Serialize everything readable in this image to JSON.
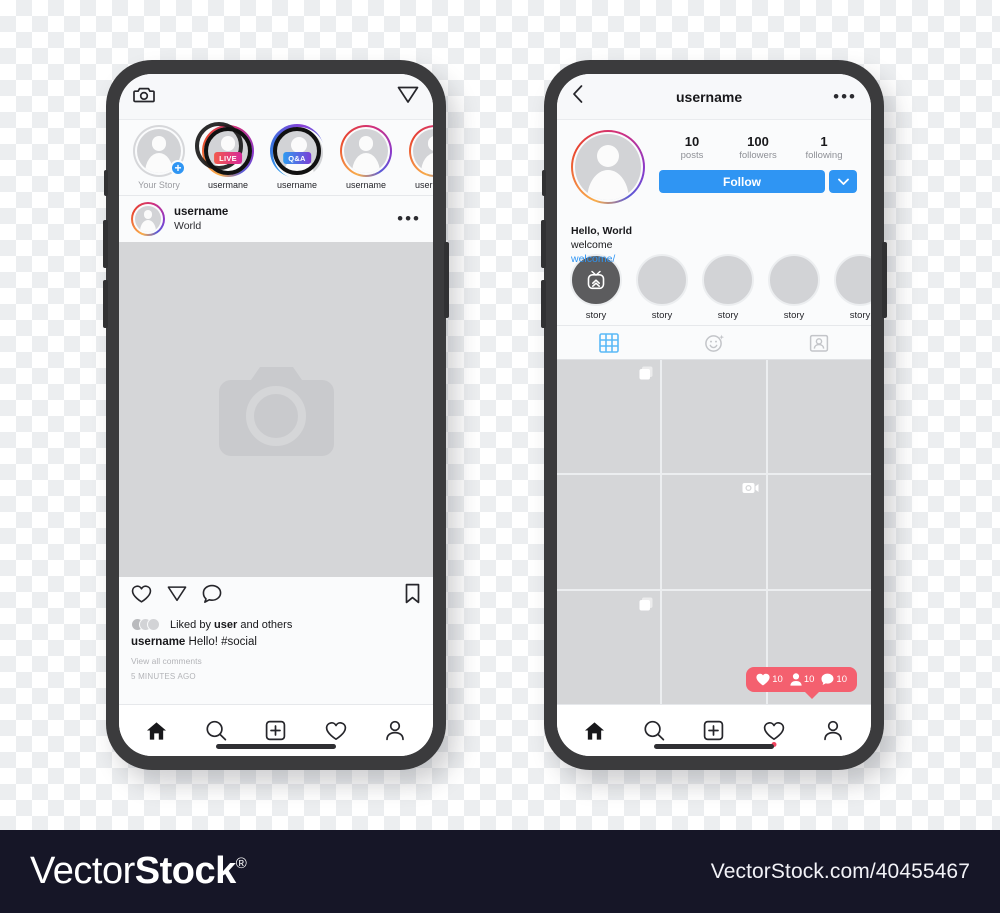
{
  "feed_phone": {
    "topbar": {
      "camera_icon": "camera-icon",
      "direct_icon": "paper-plane-icon"
    },
    "stories": [
      {
        "label": "Your Story",
        "ring": "none",
        "badge": null,
        "has_plus": true
      },
      {
        "label": "usermane",
        "ring": "gradient",
        "badge": "LIVE",
        "has_plus": false
      },
      {
        "label": "username",
        "ring": "blue-gradient",
        "badge": "Q&A",
        "has_plus": false
      },
      {
        "label": "username",
        "ring": "gradient",
        "badge": null,
        "has_plus": false
      },
      {
        "label": "username",
        "ring": "gradient",
        "badge": null,
        "has_plus": false
      }
    ],
    "post": {
      "username": "username",
      "location": "World",
      "more_icon": "more-options-icon",
      "actions": [
        "heart-icon",
        "paper-plane-icon",
        "comment-icon",
        "bookmark-icon"
      ],
      "likes_prefix": "Liked by ",
      "likes_user": "user",
      "likes_suffix": " and others",
      "caption_user": "username",
      "caption_text": " Hello! #social",
      "view_comments": "View all comments",
      "time_ago": "5 MINUTES AGO"
    },
    "bottom_nav": [
      "home-icon",
      "search-icon",
      "add-post-icon",
      "activity-icon",
      "profile-icon"
    ]
  },
  "profile_phone": {
    "topbar": {
      "back_icon": "back-chevron-icon",
      "title": "username",
      "more_icon": "more-options-icon"
    },
    "stats": [
      {
        "num": "10",
        "label": "posts"
      },
      {
        "num": "100",
        "label": "followers"
      },
      {
        "num": "1",
        "label": "following"
      }
    ],
    "follow_label": "Follow",
    "follow_dropdown_icon": "chevron-down-icon",
    "bio": {
      "name": "Hello, World",
      "text": "welcome",
      "link": "welcome/"
    },
    "highlights": [
      {
        "label": "story",
        "icon": "igtv-icon"
      },
      {
        "label": "story",
        "icon": null
      },
      {
        "label": "story",
        "icon": null
      },
      {
        "label": "story",
        "icon": null
      },
      {
        "label": "story",
        "icon": null
      }
    ],
    "tabs": [
      {
        "icon": "grid-icon",
        "active": true
      },
      {
        "icon": "reels-smiley-icon",
        "active": false
      },
      {
        "icon": "tagged-person-icon",
        "active": false
      }
    ],
    "grid_cells": [
      {
        "overlay": "multi-post-icon"
      },
      {
        "overlay": null
      },
      {
        "overlay": null
      },
      {
        "overlay": null
      },
      {
        "overlay": "video-icon"
      },
      {
        "overlay": null
      },
      {
        "overlay": "multi-post-icon"
      },
      {
        "overlay": null
      },
      {
        "overlay": null
      }
    ],
    "notification": [
      {
        "icon": "heart-icon",
        "count": "10"
      },
      {
        "icon": "person-icon",
        "count": "10"
      },
      {
        "icon": "comment-icon",
        "count": "10"
      }
    ],
    "bottom_nav": [
      "home-icon",
      "search-icon",
      "add-post-icon",
      "activity-icon",
      "profile-icon"
    ]
  },
  "footer": {
    "brand_light": "Vector",
    "brand_bold": "Stock",
    "registered": "®",
    "url": "VectorStock.com/40455467",
    "bar_color": "#161627"
  },
  "colors": {
    "accent_blue": "#2f95f3",
    "notif_red": "#f4606f"
  }
}
